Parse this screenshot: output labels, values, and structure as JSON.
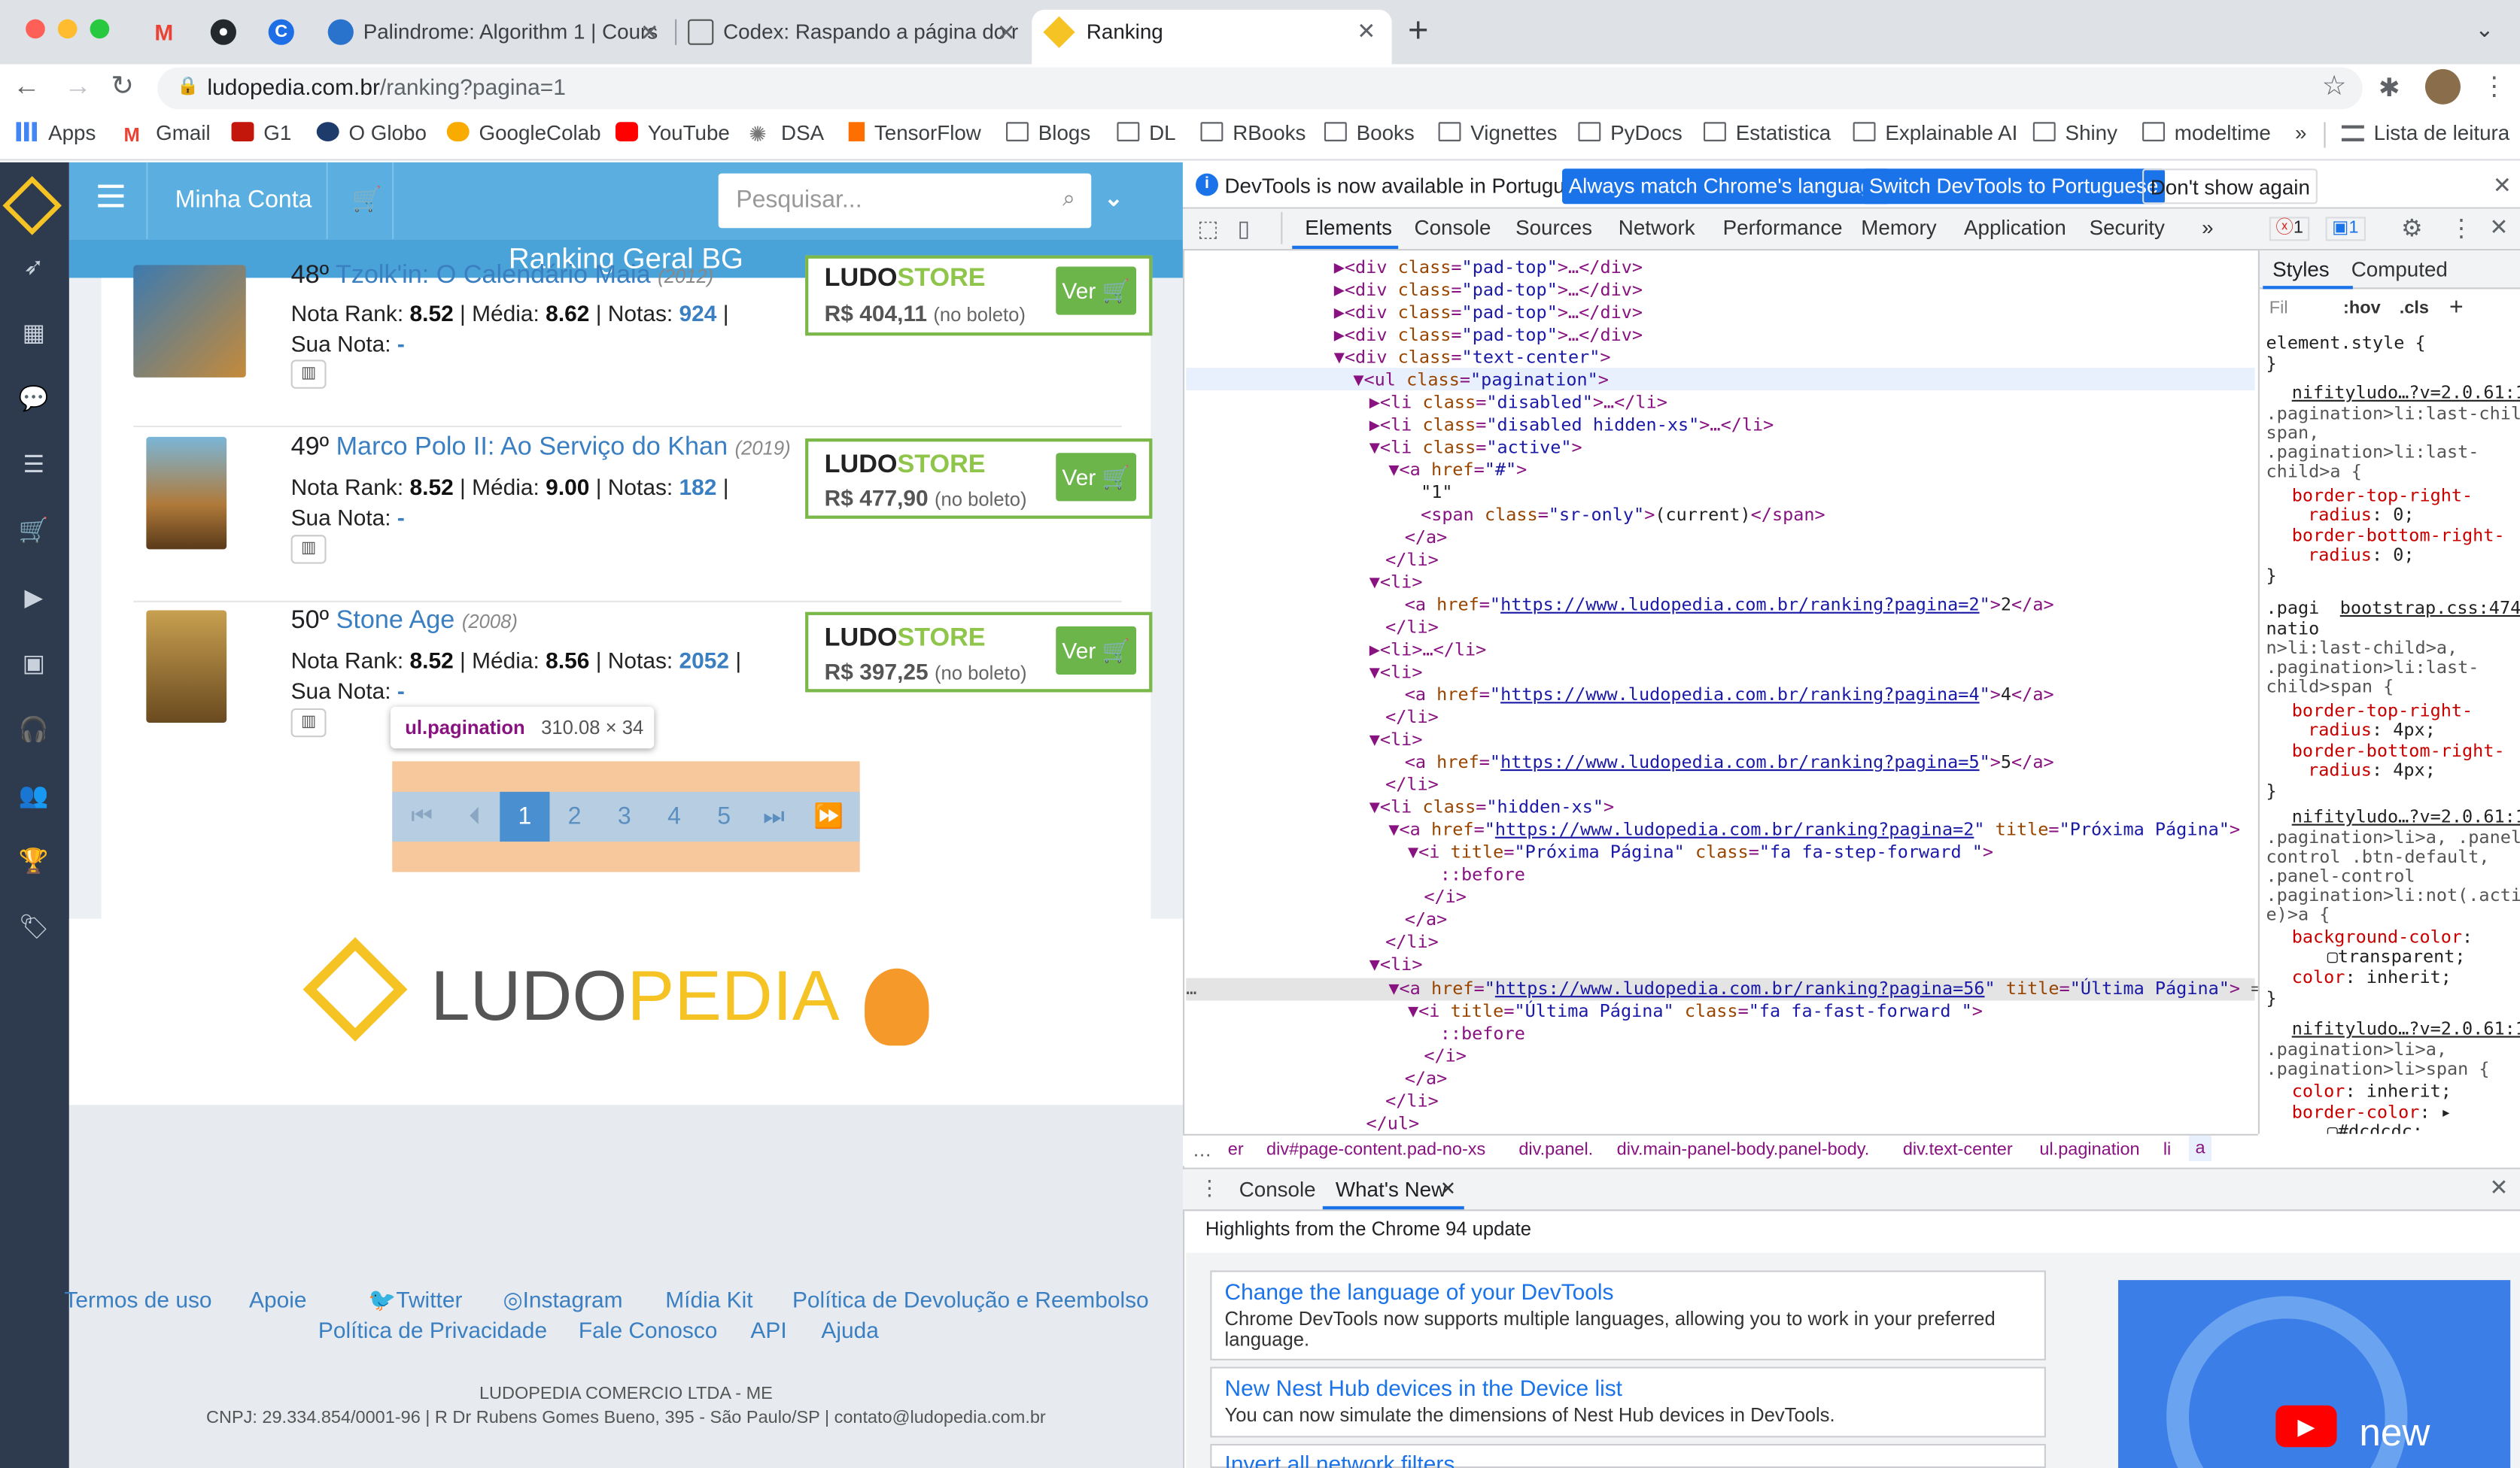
{
  "browser": {
    "tabs": [
      {
        "title": "Palindrome: Algorithm 1 | Cours"
      },
      {
        "title": "Codex: Raspando a página do r"
      },
      {
        "title": "Ranking"
      }
    ],
    "url_host": "ludopedia.com.br",
    "url_path": "/ranking?pagina=1",
    "bookmarks": [
      "Apps",
      "Gmail",
      "G1",
      "O Globo",
      "GoogleColab",
      "YouTube",
      "DSA",
      "TensorFlow",
      "Blogs",
      "DL",
      "RBooks",
      "Books",
      "Vignettes",
      "PyDocs",
      "Estatistica",
      "Explainable AI",
      "Shiny",
      "modeltime"
    ],
    "bookmarks_more": "»",
    "reading_list": "Lista de leitura"
  },
  "site": {
    "account": "Minha Conta",
    "search_placeholder": "Pesquisar...",
    "section_title": "Ranking Geral BG",
    "games": [
      {
        "pos": "48º",
        "name": "Tzolk'in: O Calendário Maia",
        "year": "(2012)",
        "nota_rank": "8.52",
        "media": "8.62",
        "notas": "924",
        "price": "R$ 404,11",
        "price_note": "(no boleto)"
      },
      {
        "pos": "49º",
        "name": "Marco Polo II: Ao Serviço do Khan",
        "year": "(2019)",
        "nota_rank": "8.52",
        "media": "9.00",
        "notas": "182",
        "price": "R$ 477,90",
        "price_note": "(no boleto)"
      },
      {
        "pos": "50º",
        "name": "Stone Age",
        "year": "(2008)",
        "nota_rank": "8.52",
        "media": "8.56",
        "notas": "2052",
        "price": "R$ 397,25",
        "price_note": "(no boleto)"
      }
    ],
    "labels": {
      "nota_rank": "Nota Rank:",
      "media": "Média:",
      "notas": "Notas:",
      "sua_nota": "Sua Nota:",
      "dash": "-",
      "store_a": "LUDO",
      "store_b": "STORE",
      "ver": "Ver"
    },
    "tooltip": {
      "selector": "ul.pagination",
      "size": "310.08 × 34"
    },
    "pagination": [
      "1",
      "2",
      "3",
      "4",
      "5"
    ],
    "logo_a": "LUDO",
    "logo_b": "PEDIA",
    "footer_links_1": [
      "Termos de uso",
      "Apoie",
      "Twitter",
      "Instagram",
      "Mídia Kit",
      "Política de Devolução e Reembolso"
    ],
    "footer_links_2": [
      "Política de Privacidade",
      "Fale Conosco",
      "API",
      "Ajuda"
    ],
    "company": "LUDOPEDIA COMERCIO LTDA - ME",
    "cnpj": "CNPJ: 29.334.854/0001-96 | R Dr Rubens Gomes Bueno, 395 - São Paulo/SP | contato@ludopedia.com.br"
  },
  "devtools": {
    "info": "DevTools is now available in Portuguese!",
    "btn_match": "Always match Chrome's language",
    "btn_switch": "Switch DevTools to Portuguese",
    "btn_dont": "Don't show again",
    "tabs": [
      "Elements",
      "Console",
      "Sources",
      "Network",
      "Performance",
      "Memory",
      "Application",
      "Security"
    ],
    "more": "»",
    "errors": "1",
    "messages": "1",
    "styles_tab": "Styles",
    "computed_tab": "Computed",
    "filter": "Fil",
    "hov": ":hov",
    "cls": ".cls",
    "crumbs": [
      "er",
      "div#page-content.pad-no-xs",
      "div.panel.",
      "div.main-panel-body.panel-body.",
      "div.text-center",
      "ul.pagination",
      "li",
      "a"
    ],
    "drawer_tabs": [
      "Console",
      "What's New"
    ],
    "drawer_title": "Highlights from the Chrome 94 update",
    "news": [
      {
        "title": "Change the language of your DevTools",
        "desc": "Chrome DevTools now supports multiple languages, allowing you to work in your preferred language."
      },
      {
        "title": "New Nest Hub devices in the Device list",
        "desc": "You can now simulate the dimensions of Nest Hub devices in DevTools."
      },
      {
        "title": "Invert all network filters",
        "desc": ""
      }
    ],
    "video_label": "new"
  }
}
